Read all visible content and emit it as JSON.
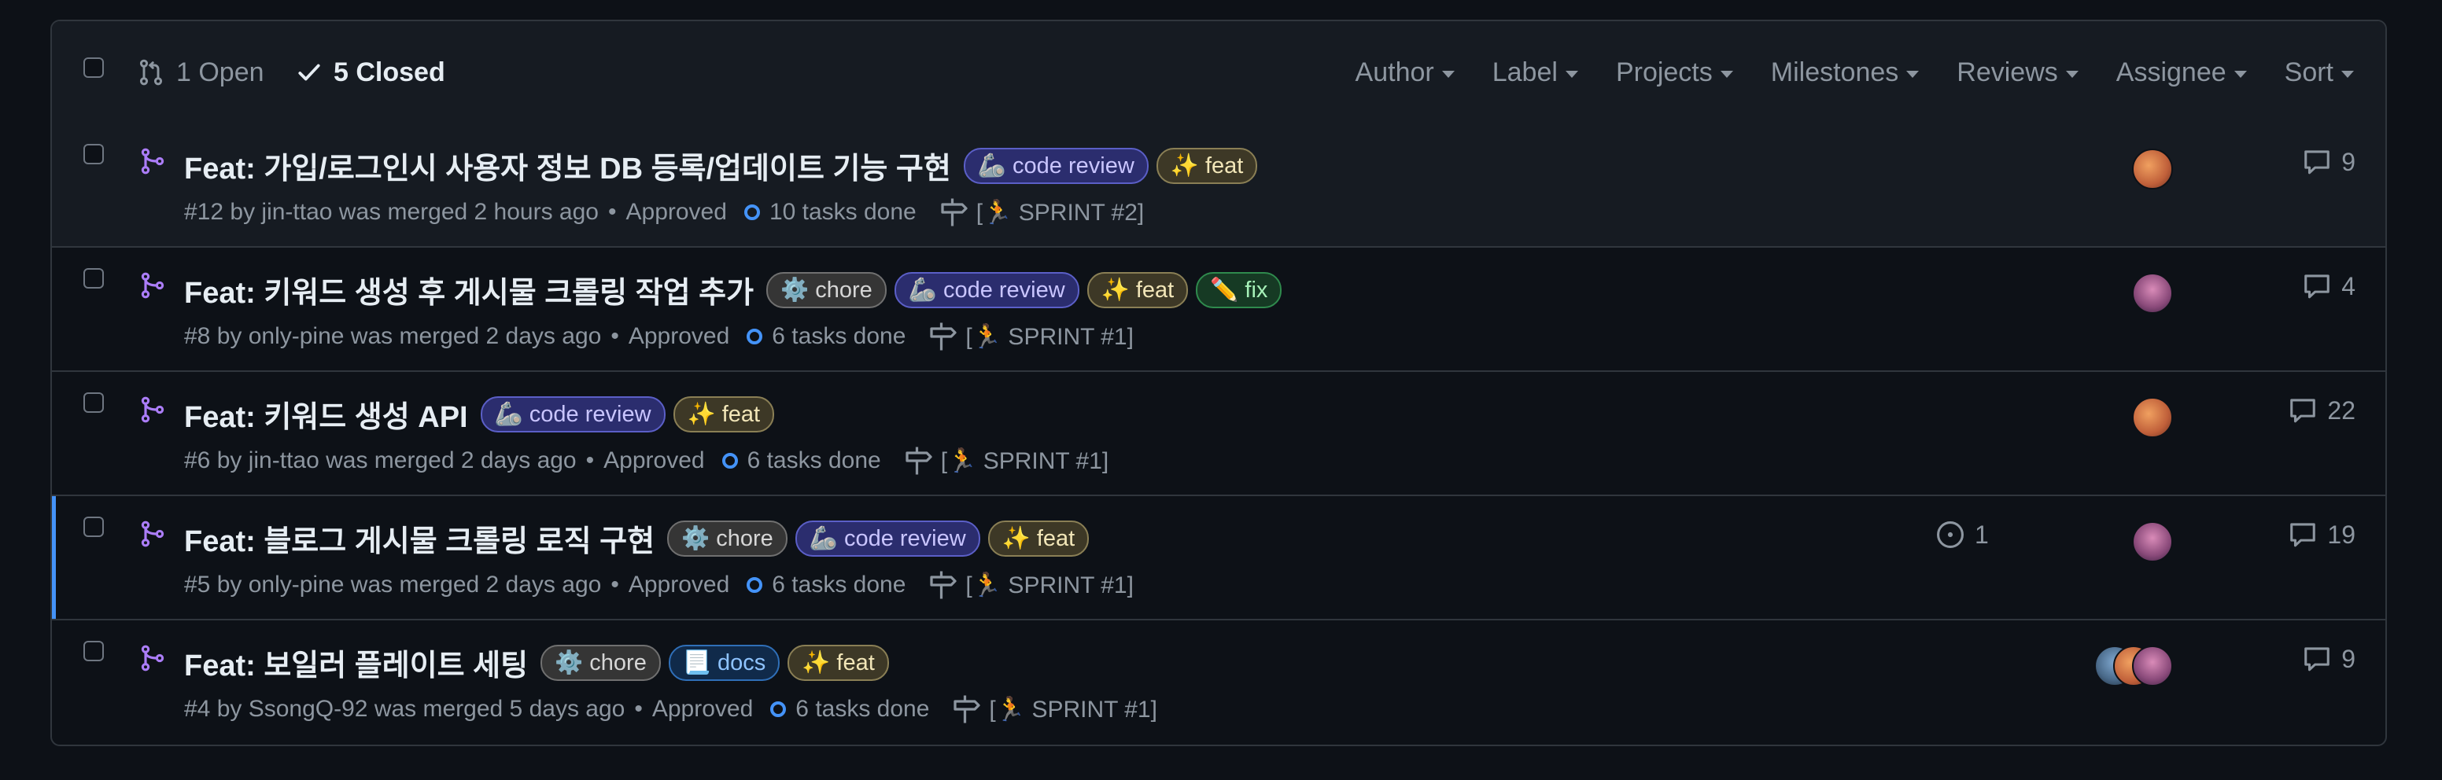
{
  "header": {
    "open_label": "1 Open",
    "closed_label": "5 Closed",
    "filters": [
      "Author",
      "Label",
      "Projects",
      "Milestones",
      "Reviews",
      "Assignee",
      "Sort"
    ]
  },
  "colors": {
    "accent": "#4493f8",
    "merged": "#ab7df8",
    "bg": "#0d1117",
    "border": "#30363d"
  },
  "labels": {
    "code_review": {
      "text": "🦾 code review",
      "fg": "#c9c5ff",
      "bg": "#2b2d6e",
      "border": "#5b5fc7"
    },
    "feat": {
      "text": "✨ feat",
      "fg": "#f2e6b8",
      "bg": "#3d3826",
      "border": "#8a7f55"
    },
    "chore": {
      "text": "⚙️ chore",
      "fg": "#d6d6d6",
      "bg": "#353535",
      "border": "#707070"
    },
    "fix": {
      "text": "✏️ fix",
      "fg": "#a6f0b8",
      "bg": "#163a24",
      "border": "#2f8a4d"
    },
    "docs": {
      "text": "📃 docs",
      "fg": "#8ec3ff",
      "bg": "#102a4a",
      "border": "#2f6fb8"
    }
  },
  "rows": [
    {
      "title": "Feat: 가입/로그인시 사용자 정보 DB 등록/업데이트 기능 구현",
      "labels": [
        "code_review",
        "feat"
      ],
      "meta": "#12 by jin-ttao was merged 2 hours ago",
      "approved": "Approved",
      "tasks": "10 tasks done",
      "milestone": "[🏃 SPRINT #2]",
      "comments": "9",
      "linked_issues": ""
    },
    {
      "title": "Feat: 키워드 생성 후 게시물 크롤링 작업 추가",
      "labels": [
        "chore",
        "code_review",
        "feat",
        "fix"
      ],
      "meta": "#8 by only-pine was merged 2 days ago",
      "approved": "Approved",
      "tasks": "6 tasks done",
      "milestone": "[🏃 SPRINT #1]",
      "comments": "4",
      "linked_issues": ""
    },
    {
      "title": "Feat: 키워드 생성 API",
      "labels": [
        "code_review",
        "feat"
      ],
      "meta": "#6 by jin-ttao was merged 2 days ago",
      "approved": "Approved",
      "tasks": "6 tasks done",
      "milestone": "[🏃 SPRINT #1]",
      "comments": "22",
      "linked_issues": ""
    },
    {
      "title": "Feat: 블로그 게시물 크롤링 로직 구현",
      "labels": [
        "chore",
        "code_review",
        "feat"
      ],
      "meta": "#5 by only-pine was merged 2 days ago",
      "approved": "Approved",
      "tasks": "6 tasks done",
      "milestone": "[🏃 SPRINT #1]",
      "comments": "19",
      "linked_issues": "1"
    },
    {
      "title": "Feat: 보일러 플레이트 세팅",
      "labels": [
        "chore",
        "docs",
        "feat"
      ],
      "meta": "#4 by SsongQ-92 was merged 5 days ago",
      "approved": "Approved",
      "tasks": "6 tasks done",
      "milestone": "[🏃 SPRINT #1]",
      "comments": "9",
      "linked_issues": ""
    }
  ]
}
